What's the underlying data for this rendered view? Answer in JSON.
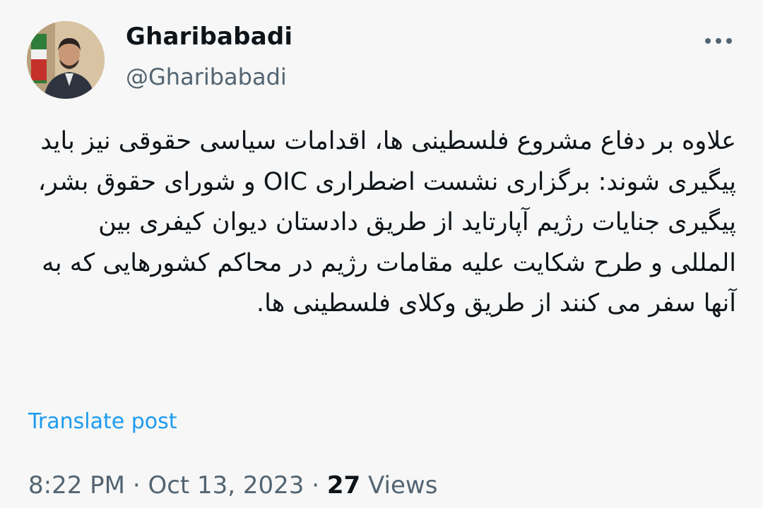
{
  "author": {
    "display_name": "Gharibabadi",
    "handle": "@Gharibabadi"
  },
  "post": {
    "text": "علاوه بر دفاع مشروع فلسطینی ها، اقدامات سیاسی حقوقی نیز باید پیگیری شوند: برگزاری نشست اضطراری OIC و شورای حقوق بشر، پیگیری جنایات رژیم آپارتاید از طریق دادستان دیوان کیفری بین المللی و طرح شکایت علیه مقامات رژیم در محاکم کشورهایی که به آنها سفر می کنند از طریق وکلای فلسطینی ها.",
    "translate_label": "Translate post"
  },
  "meta": {
    "time": "8:22 PM",
    "separator": "·",
    "date": "Oct 13, 2023",
    "views_count": "27",
    "views_label": "Views"
  },
  "icons": {
    "more": "more-horizontal-icon",
    "avatar": "profile-photo"
  },
  "colors": {
    "link": "#1d9bf0",
    "secondary_text": "#536471",
    "primary_text": "#0f1419",
    "background": "#f6f7f6"
  }
}
